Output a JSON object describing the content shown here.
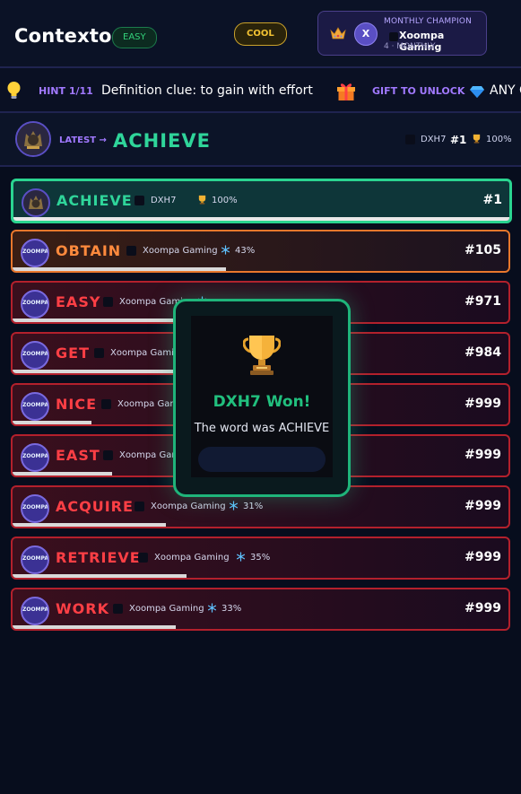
{
  "header": {
    "title": "Contexto",
    "difficulty": "EASY",
    "cool_badge": "COOL",
    "champion": {
      "label": "MONTHLY CHAMPION",
      "avatar_initial": "X",
      "name": "Xoompa Gaming",
      "subtitle": "4 · MONTHLY"
    }
  },
  "hint_bar": {
    "hint_label": "HINT 1/11",
    "hint_text": "Definition clue: to gain with effort",
    "gift_label": "GIFT TO UNLOCK",
    "any_label": "ANY C"
  },
  "latest": {
    "label": "LATEST →",
    "word": "ACHIEVE",
    "user": "DXH7",
    "rank": "#1",
    "percent": "100%"
  },
  "guesses": [
    {
      "word": "ACHIEVE",
      "user": "DXH7",
      "percent": "100%",
      "rank": "#1",
      "state": "top",
      "progress": 1.0,
      "icon": "trophy-icon"
    },
    {
      "word": "OBTAIN",
      "user": "Xoompa Gaming",
      "percent": "43%",
      "rank": "#105",
      "state": "orange",
      "progress": 0.43,
      "icon": "snowflake-icon"
    },
    {
      "word": "EASY",
      "user": "Xoompa Gaming",
      "percent": "",
      "rank": "#971",
      "state": "red",
      "progress": 0.37,
      "icon": "snowflake-icon"
    },
    {
      "word": "GET",
      "user": "Xoompa Gaming",
      "percent": "",
      "rank": "#984",
      "state": "red",
      "progress": 0.33,
      "icon": "snowflake-icon"
    },
    {
      "word": "NICE",
      "user": "Xoompa Gaming",
      "percent": "",
      "rank": "#999",
      "state": "red",
      "progress": 0.16,
      "icon": "snowflake-icon"
    },
    {
      "word": "EAST",
      "user": "Xoompa Gaming",
      "percent": "",
      "rank": "#999",
      "state": "red",
      "progress": 0.2,
      "icon": "snowflake-icon"
    },
    {
      "word": "ACQUIRE",
      "user": "Xoompa Gaming",
      "percent": "31%",
      "rank": "#999",
      "state": "red",
      "progress": 0.31,
      "icon": "snowflake-icon"
    },
    {
      "word": "RETRIEVE",
      "user": "Xoompa Gaming",
      "percent": "35%",
      "rank": "#999",
      "state": "red",
      "progress": 0.35,
      "icon": "snowflake-icon"
    },
    {
      "word": "WORK",
      "user": "Xoompa Gaming",
      "percent": "33%",
      "rank": "#999",
      "state": "red",
      "progress": 0.33,
      "icon": "snowflake-icon"
    }
  ],
  "avatar_text": "ZOOMPA",
  "overlay": {
    "headline": "DXH7 Won!",
    "message": "The word was ACHIEVE",
    "button_label": ""
  },
  "colors": {
    "accent_green": "#2fd59a",
    "accent_purple": "#a179ff",
    "rank_red": "#ff3f45",
    "rank_orange": "#ff8a3d"
  }
}
